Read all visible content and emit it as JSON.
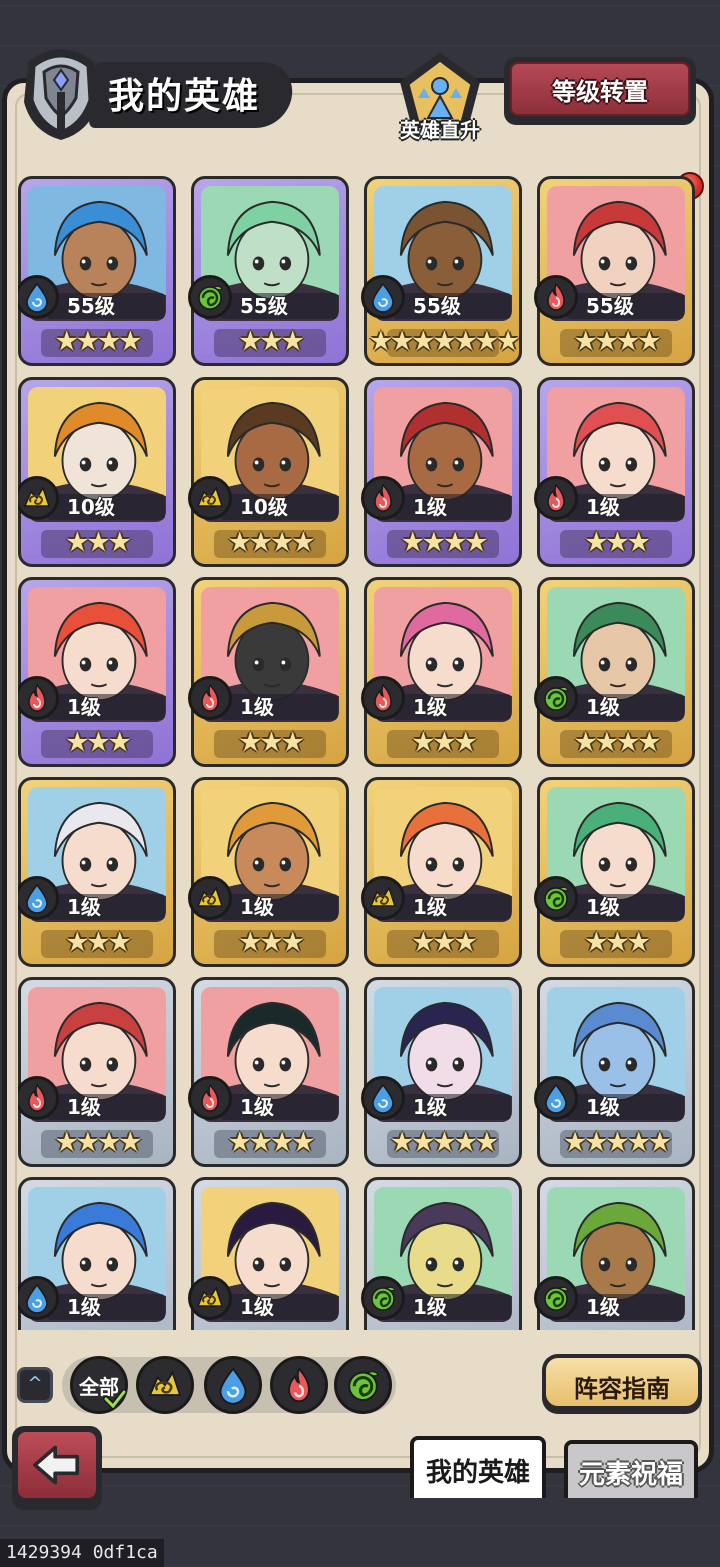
{
  "header": {
    "title": "我的英雄",
    "direct_up_label": "英雄直升",
    "level_reset_label": "等级转置"
  },
  "elements": {
    "water": {
      "color": "#4a9ee6"
    },
    "nature": {
      "color": "#6cc43a"
    },
    "fire": {
      "color": "#e8585a"
    },
    "earth": {
      "color": "#e8c63a"
    }
  },
  "heroes": [
    {
      "level": "55级",
      "stars": "★★★★",
      "element": "water",
      "frame": "purple",
      "hair": "#3a8ed6",
      "skin": "#b8825a",
      "bg": "#7fb8e0"
    },
    {
      "level": "55级",
      "stars": "★★★",
      "element": "nature",
      "frame": "purple",
      "hair": "#7fd0a2",
      "skin": "#bfe0c6",
      "bg": "#9ad9b4"
    },
    {
      "level": "55级",
      "stars": "★★★★★★★",
      "element": "water",
      "frame": "gold",
      "hair": "#7a5332",
      "skin": "#8b5e3a",
      "bg": "#9fd0e8"
    },
    {
      "level": "55级",
      "stars": "★★★★",
      "element": "fire",
      "frame": "gold",
      "hair": "#c83a3a",
      "skin": "#f1d2c0",
      "bg": "#f0a0a0"
    },
    {
      "level": "10级",
      "stars": "★★★",
      "element": "earth",
      "frame": "purple",
      "hair": "#e08a2a",
      "skin": "#f0e4d8",
      "bg": "#f1d27a"
    },
    {
      "level": "10级",
      "stars": "★★★★",
      "element": "earth",
      "frame": "gold",
      "hair": "#5a3a20",
      "skin": "#a86a42",
      "bg": "#f1d27a"
    },
    {
      "level": "1级",
      "stars": "★★★★",
      "element": "fire",
      "frame": "purple",
      "hair": "#b03030",
      "skin": "#a86a42",
      "bg": "#f0a0a0"
    },
    {
      "level": "1级",
      "stars": "★★★",
      "element": "fire",
      "frame": "purple",
      "hair": "#e05050",
      "skin": "#f6dccc",
      "bg": "#f0a0a0"
    },
    {
      "level": "1级",
      "stars": "★★★",
      "element": "fire",
      "frame": "purple",
      "hair": "#e8503a",
      "skin": "#f6dccc",
      "bg": "#f0a0a0"
    },
    {
      "level": "1级",
      "stars": "★★★",
      "element": "fire",
      "frame": "gold",
      "hair": "#c89a3a",
      "skin": "#3a3a3a",
      "bg": "#f0a0a0"
    },
    {
      "level": "1级",
      "stars": "★★★",
      "element": "fire",
      "frame": "gold",
      "hair": "#e06aa0",
      "skin": "#f6dccc",
      "bg": "#f0a0a0"
    },
    {
      "level": "1级",
      "stars": "★★★★",
      "element": "nature",
      "frame": "gold",
      "hair": "#3a8a5a",
      "skin": "#e6c8a8",
      "bg": "#9ad9b4"
    },
    {
      "level": "1级",
      "stars": "★★★",
      "element": "water",
      "frame": "gold",
      "hair": "#e8e8ee",
      "skin": "#f6dccc",
      "bg": "#9fd0e8"
    },
    {
      "level": "1级",
      "stars": "★★★",
      "element": "earth",
      "frame": "gold",
      "hair": "#e09a3a",
      "skin": "#c88a5a",
      "bg": "#f1d27a"
    },
    {
      "level": "1级",
      "stars": "★★★",
      "element": "earth",
      "frame": "gold",
      "hair": "#e8703a",
      "skin": "#f6dccc",
      "bg": "#f1d27a"
    },
    {
      "level": "1级",
      "stars": "★★★",
      "element": "nature",
      "frame": "gold",
      "hair": "#4ab07a",
      "skin": "#f6dccc",
      "bg": "#9ad9b4"
    },
    {
      "level": "1级",
      "stars": "★★★★",
      "element": "fire",
      "frame": "grey",
      "hair": "#c84040",
      "skin": "#f6dccc",
      "bg": "#f0a0a0"
    },
    {
      "level": "1级",
      "stars": "★★★★",
      "element": "fire",
      "frame": "grey",
      "hair": "#1a2a2a",
      "skin": "#f6dccc",
      "bg": "#f0a0a0"
    },
    {
      "level": "1级",
      "stars": "★★★★★",
      "element": "water",
      "frame": "grey",
      "hair": "#2a2450",
      "skin": "#f0dde8",
      "bg": "#9fd0e8"
    },
    {
      "level": "1级",
      "stars": "★★★★★",
      "element": "water",
      "frame": "grey",
      "hair": "#5a8ad0",
      "skin": "#9ac0e8",
      "bg": "#9fd0e8"
    },
    {
      "level": "1级",
      "stars": "★★★",
      "element": "water",
      "frame": "grey",
      "hair": "#3a7ad8",
      "skin": "#f6dccc",
      "bg": "#9fd0e8"
    },
    {
      "level": "1级",
      "stars": "★★★",
      "element": "earth",
      "frame": "grey",
      "hair": "#2a1a40",
      "skin": "#f6dccc",
      "bg": "#f1d27a"
    },
    {
      "level": "1级",
      "stars": "★★★",
      "element": "nature",
      "frame": "grey",
      "hair": "#4a3a5a",
      "skin": "#e8dc8a",
      "bg": "#9ad9b4"
    },
    {
      "level": "1级",
      "stars": "★★★",
      "element": "nature",
      "frame": "grey",
      "hair": "#6aa83a",
      "skin": "#a87a4a",
      "bg": "#9ad9b4"
    }
  ],
  "filters": {
    "all_label": "全部",
    "elements": [
      "earth",
      "water",
      "fire",
      "nature"
    ]
  },
  "lineup_guide_label": "阵容指南",
  "tabs": {
    "active": "我的英雄",
    "inactive": "元素祝福"
  },
  "watermark": "1429394 0df1ca"
}
